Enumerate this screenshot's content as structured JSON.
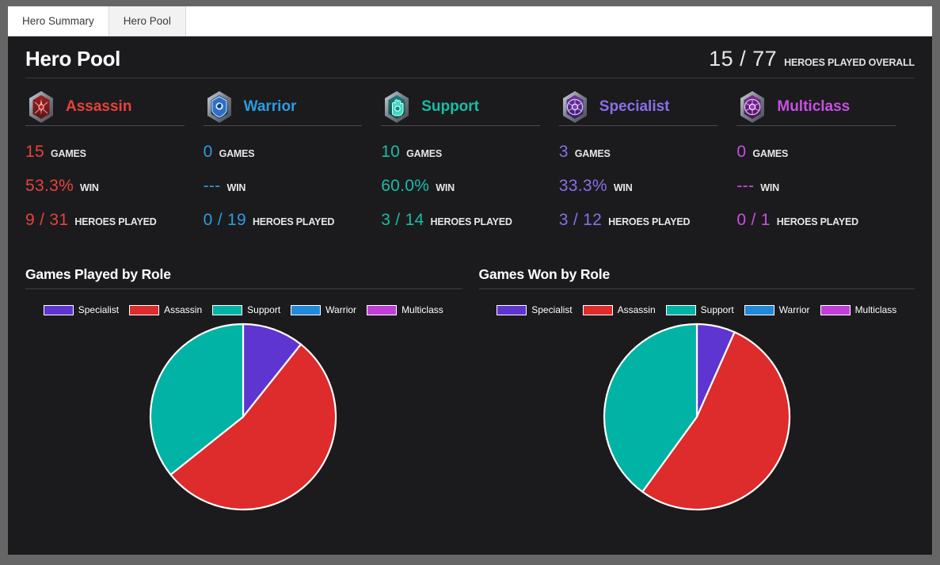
{
  "tabs": [
    {
      "label": "Hero Summary",
      "active": true
    },
    {
      "label": "Hero Pool",
      "active": false
    }
  ],
  "header": {
    "title": "Hero Pool",
    "overall_value": "15 / 77",
    "overall_label": "HEROES PLAYED OVERALL"
  },
  "labels": {
    "games": "GAMES",
    "win": "WIN",
    "heroes_played": "HEROES PLAYED"
  },
  "colors": {
    "assassin": "#E8413C",
    "warrior": "#2E9BE0",
    "support": "#1ABCA8",
    "specialist": "#8A6FE8",
    "multiclass": "#C94FE0",
    "pie_specialist": "#5E35D0",
    "pie_assassin": "#DE2B2B",
    "pie_support": "#00B3A4",
    "pie_warrior": "#2288D8",
    "pie_multiclass": "#C13FD8",
    "panel_bg": "#1b1b1d"
  },
  "roles": [
    {
      "name": "Assassin",
      "icon": "assassin-role-icon",
      "color": "#E8413C",
      "games": "15",
      "win": "53.3%",
      "heroes_played": "9 / 31"
    },
    {
      "name": "Warrior",
      "icon": "warrior-role-icon",
      "color": "#2E9BE0",
      "games": "0",
      "win": "---",
      "heroes_played": "0 / 19"
    },
    {
      "name": "Support",
      "icon": "support-role-icon",
      "color": "#1ABCA8",
      "games": "10",
      "win": "60.0%",
      "heroes_played": "3 / 14"
    },
    {
      "name": "Specialist",
      "icon": "specialist-role-icon",
      "color": "#8A6FE8",
      "games": "3",
      "win": "33.3%",
      "heroes_played": "3 / 12"
    },
    {
      "name": "Multiclass",
      "icon": "multiclass-role-icon",
      "color": "#C94FE0",
      "games": "0",
      "win": "---",
      "heroes_played": "0 / 1"
    }
  ],
  "chart_data": [
    {
      "type": "pie",
      "title": "Games Played by Role",
      "legend_position": "top-center",
      "categories": [
        "Specialist",
        "Assassin",
        "Support",
        "Warrior",
        "Multiclass"
      ],
      "values": [
        3,
        15,
        10,
        0,
        0
      ],
      "colors": [
        "#5E35D0",
        "#DE2B2B",
        "#00B3A4",
        "#2288D8",
        "#C13FD8"
      ],
      "total": 28,
      "start_angle_deg": 0,
      "direction": "clockwise"
    },
    {
      "type": "pie",
      "title": "Games Won by Role",
      "legend_position": "top-center",
      "categories": [
        "Specialist",
        "Assassin",
        "Support",
        "Warrior",
        "Multiclass"
      ],
      "values": [
        1,
        8,
        6,
        0,
        0
      ],
      "colors": [
        "#5E35D0",
        "#DE2B2B",
        "#00B3A4",
        "#2288D8",
        "#C13FD8"
      ],
      "total": 15,
      "start_angle_deg": 0,
      "direction": "clockwise"
    }
  ]
}
